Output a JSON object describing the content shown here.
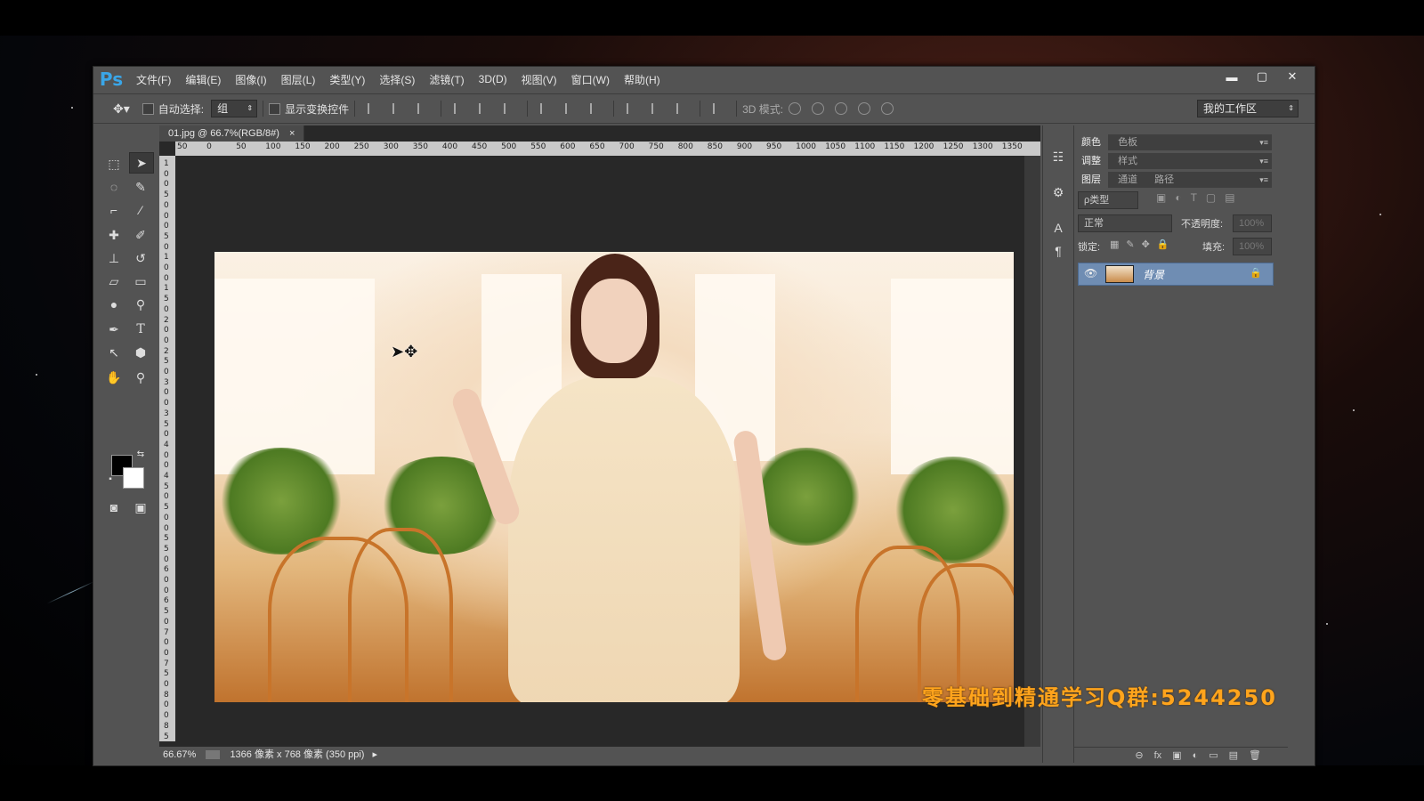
{
  "menubar": {
    "logo": "Ps",
    "items": [
      "文件(F)",
      "编辑(E)",
      "图像(I)",
      "图层(L)",
      "类型(Y)",
      "选择(S)",
      "滤镜(T)",
      "3D(D)",
      "视图(V)",
      "窗口(W)",
      "帮助(H)"
    ],
    "minimize": "▬",
    "maximize": "▢",
    "close": "✕"
  },
  "options": {
    "auto_select_label": "自动选择:",
    "auto_select_value": "组",
    "show_transform_label": "显示变换控件",
    "mode_3d_label": "3D 模式:",
    "workspace_value": "我的工作区"
  },
  "document": {
    "tab_title": "01.jpg @ 66.7%(RGB/8#)",
    "tab_close": "×",
    "ruler_h": [
      "50",
      "0",
      "50",
      "100",
      "150",
      "200",
      "250",
      "300",
      "350",
      "400",
      "450",
      "500",
      "550",
      "600",
      "650",
      "700",
      "750",
      "800",
      "850",
      "900",
      "950",
      "1000",
      "1050",
      "1100",
      "1150",
      "1200",
      "1250",
      "1300",
      "1350"
    ],
    "ruler_v": [
      "1",
      "0",
      "0",
      "5",
      "0",
      "0",
      "0",
      "5",
      "0",
      "1",
      "0",
      "0",
      "1",
      "5",
      "0",
      "2",
      "0",
      "0",
      "2",
      "5",
      "0",
      "3",
      "0",
      "0",
      "3",
      "5",
      "0",
      "4",
      "0",
      "0",
      "4",
      "5",
      "0",
      "5",
      "0",
      "0",
      "5",
      "5",
      "0",
      "6",
      "0",
      "0",
      "6",
      "5",
      "0",
      "7",
      "0",
      "0",
      "7",
      "5",
      "0",
      "8",
      "0",
      "0",
      "8",
      "5"
    ],
    "zoom": "66.67%",
    "doc_info": "1366 像素 x 768 像素 (350 ppi)"
  },
  "panels": {
    "row1_tabs": [
      "颜色",
      "色板"
    ],
    "row2_tabs": [
      "调整",
      "样式"
    ],
    "row3_tabs": [
      "图层",
      "通道",
      "路径"
    ],
    "filter_label": "ρ类型",
    "blend_mode": "正常",
    "opacity_label": "不透明度:",
    "opacity_value": "100%",
    "lock_label": "锁定:",
    "fill_label": "填充:",
    "fill_value": "100%",
    "layer_name": "背景",
    "bottom_icons": [
      "⊖",
      "fx",
      "▣",
      "◐",
      "▭",
      "▤",
      "🗑"
    ]
  },
  "watermark": "零基础到精通学习Q群:5244250"
}
